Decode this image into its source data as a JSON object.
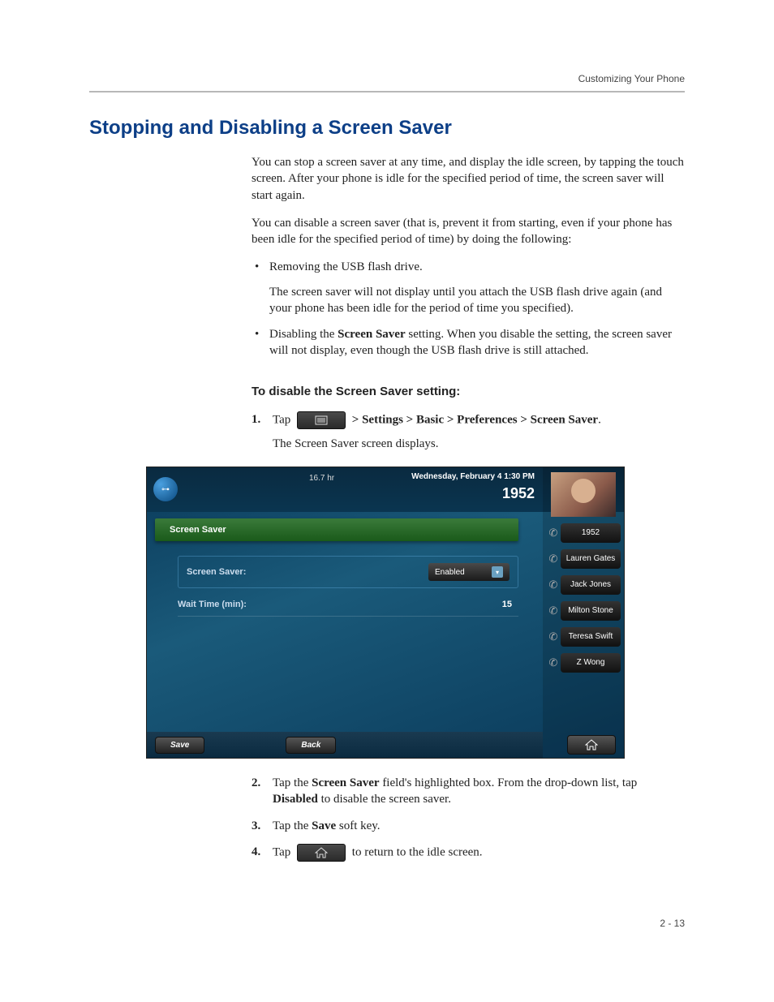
{
  "header": {
    "breadcrumb": "Customizing Your Phone"
  },
  "title": "Stopping and Disabling a Screen Saver",
  "para1": "You can stop a screen saver at any time, and display the idle screen, by tapping the touch screen. After your phone is idle for the specified period of time, the screen saver will start again.",
  "para2": "You can disable a screen saver (that is, prevent it from starting, even if your phone has been idle for the specified period of time) by doing the following:",
  "bullets": {
    "b1": "Removing the USB flash drive.",
    "b1sub": "The screen saver will not display until you attach the USB flash drive again (and your phone has been idle for the period of time you specified).",
    "b2a": "Disabling the ",
    "b2bold": "Screen Saver",
    "b2b": " setting. When you disable the setting, the screen saver will not display, even though the USB flash drive is still attached."
  },
  "subheading": "To disable the Screen Saver setting:",
  "steps": {
    "s1a": "Tap ",
    "s1b": " > Settings > Basic > Preferences > Screen Saver",
    "s1c": ".",
    "s1sub": "The Screen Saver screen displays.",
    "s2a": "Tap the ",
    "s2b": "Screen Saver",
    "s2c": " field's highlighted box. From the drop-down list, tap ",
    "s2d": "Disabled",
    "s2e": " to disable the screen saver.",
    "s3a": "Tap the ",
    "s3b": "Save",
    "s3c": " soft key.",
    "s4a": "Tap ",
    "s4b": " to return to the idle screen."
  },
  "screenshot": {
    "hours": "16.7 hr",
    "datetime": "Wednesday, February 4  1:30 PM",
    "extension": "1952",
    "screen_title": "Screen Saver",
    "fields": {
      "saver_label": "Screen Saver:",
      "saver_value": "Enabled",
      "wait_label": "Wait Time (min):",
      "wait_value": "15"
    },
    "contacts": [
      "1952",
      "Lauren Gates",
      "Jack Jones",
      "Milton Stone",
      "Teresa Swift",
      "Z Wong"
    ],
    "softkeys": {
      "save": "Save",
      "back": "Back"
    }
  },
  "page_number": "2 - 13"
}
